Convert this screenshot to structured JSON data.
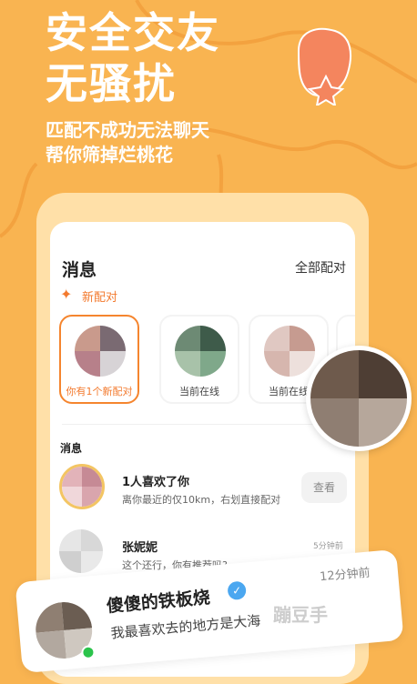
{
  "hero": {
    "line1": "安全交友",
    "line2": "无骚扰"
  },
  "subtitle": {
    "line1": "匹配不成功无法聊天",
    "line2": "帮你筛掉烂桃花"
  },
  "screen": {
    "title": "消息",
    "all_match": "全部配对",
    "new_match_label": "新配对",
    "cards": [
      {
        "caption": "你有1个新配对"
      },
      {
        "caption": "当前在线"
      },
      {
        "caption": "当前在线"
      }
    ],
    "section_label": "消息",
    "rows": [
      {
        "name": "1人喜欢了你",
        "preview": "离你最近的仅10km，右划直接配对",
        "action": "查看"
      },
      {
        "name": "张妮妮",
        "preview": "这个还行，你有推荐吗?",
        "time": "5分钟前"
      }
    ]
  },
  "bubble": {
    "name": "傻傻的铁板烧",
    "message": "我最喜欢去的地方是大海",
    "time": "12分钟前"
  },
  "watermark": "蹦豆手",
  "colors": {
    "background": "#F9B451",
    "accent": "#F37A2E",
    "online": "#2BC34B",
    "verified": "#4BA7F0"
  }
}
